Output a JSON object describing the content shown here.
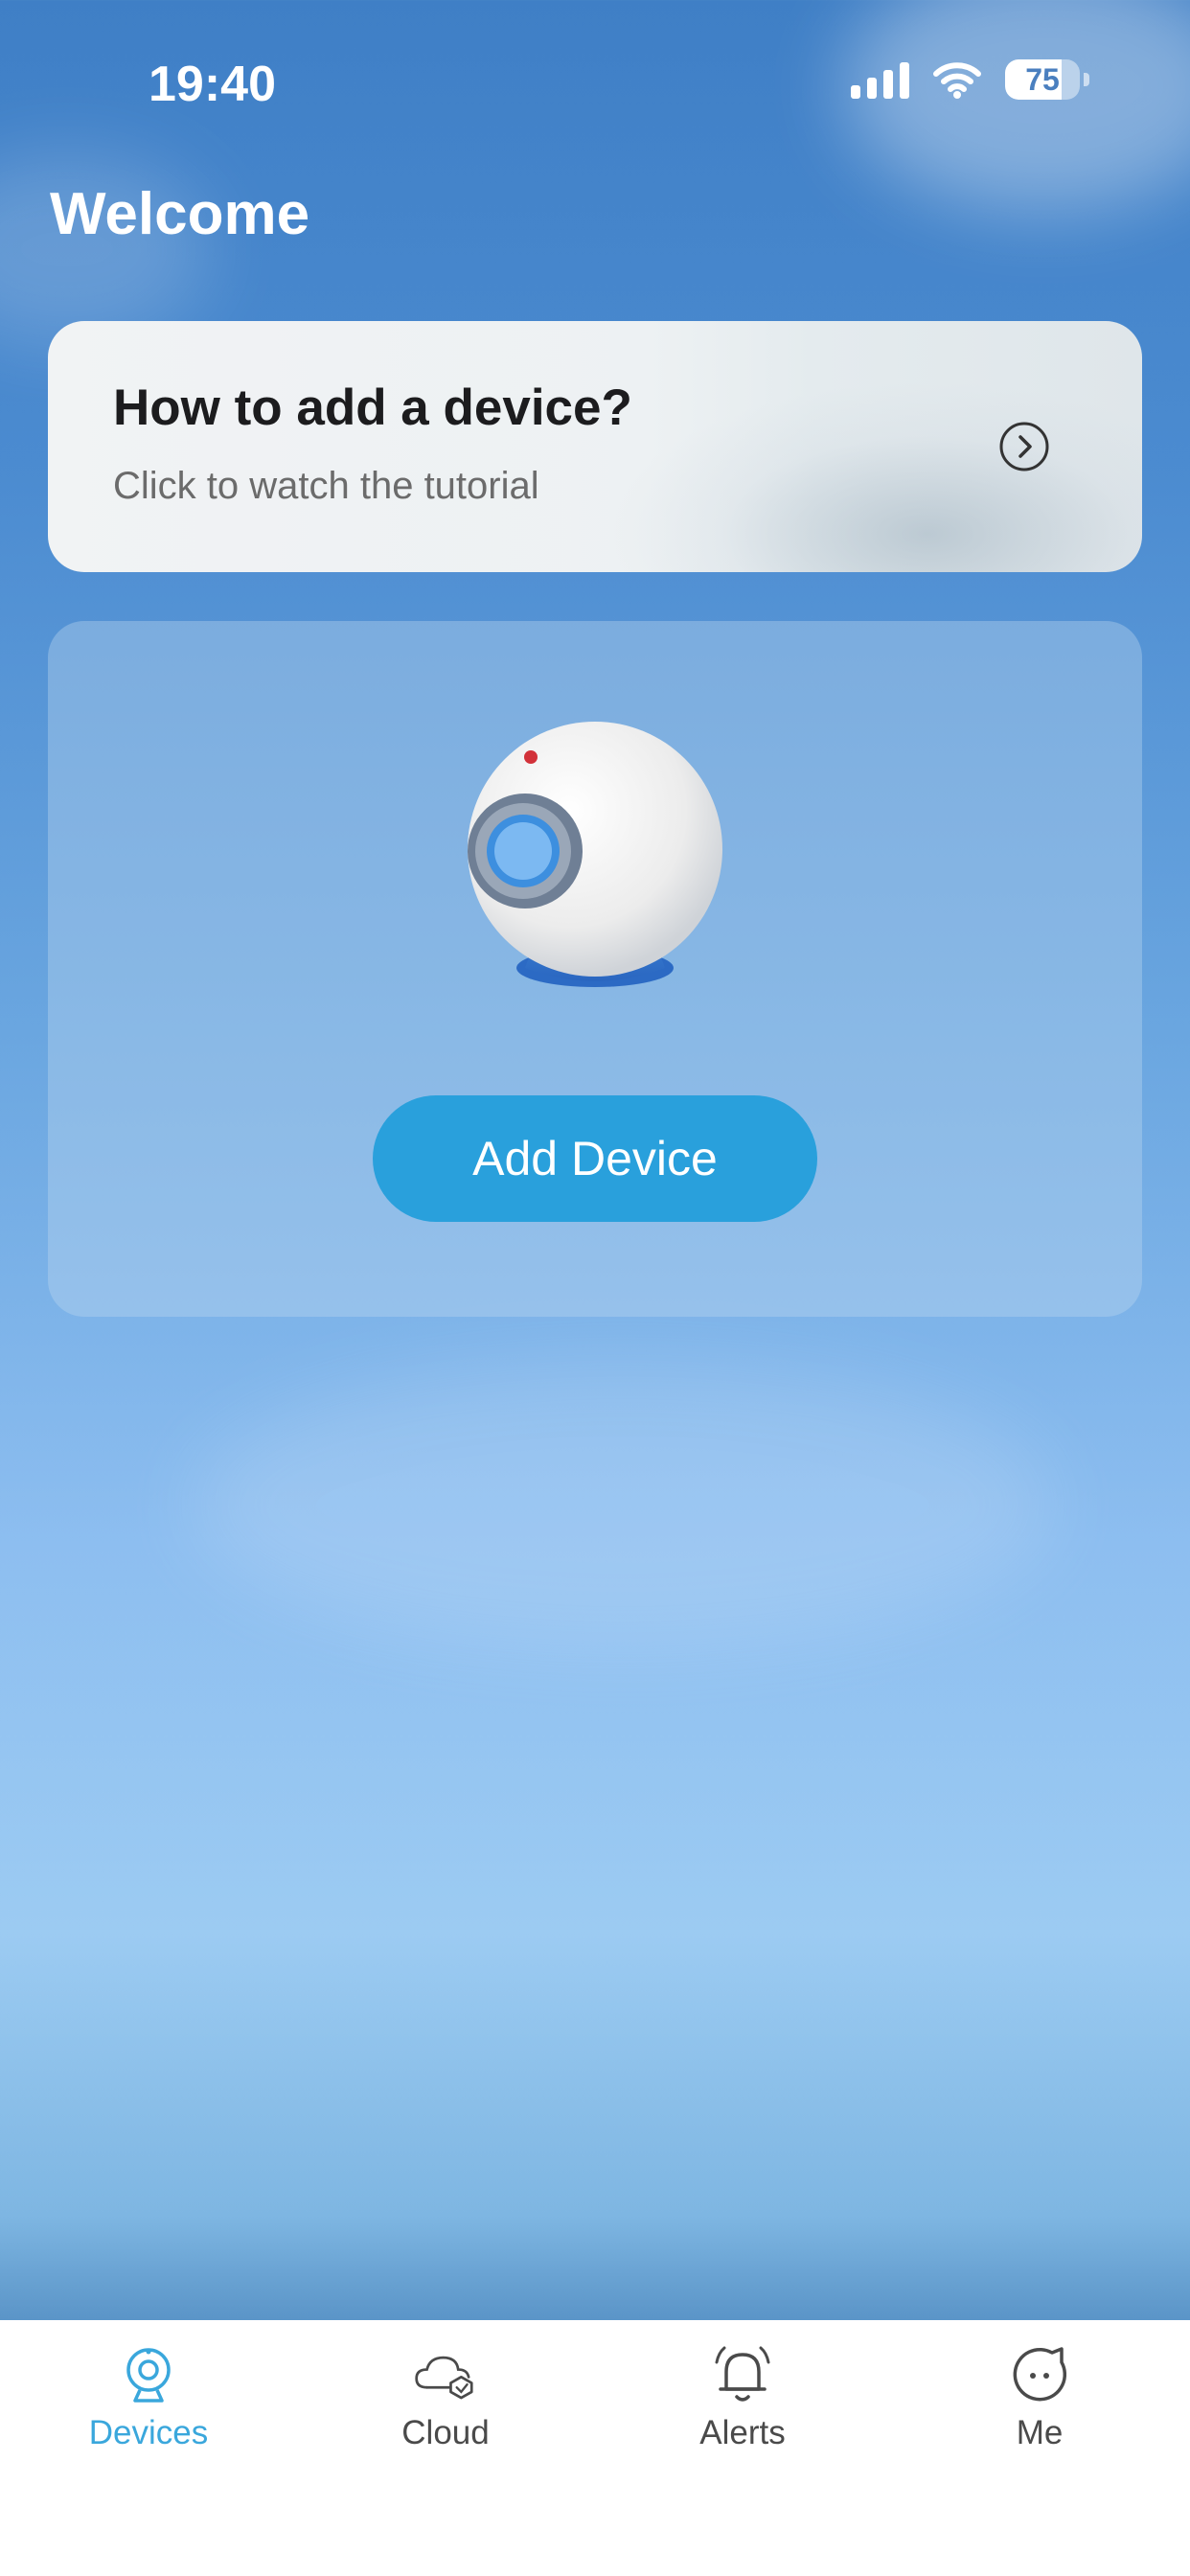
{
  "status_bar": {
    "time": "19:40",
    "battery": "75",
    "battery_level": 0.75
  },
  "header": {
    "title": "Welcome"
  },
  "tutorial": {
    "title": "How to add a device?",
    "subtitle": "Click to watch the tutorial",
    "icon": "chevron-right-circle-icon"
  },
  "device_card": {
    "illustration": "camera-icon",
    "add_button_label": "Add Device"
  },
  "tabs": [
    {
      "label": "Devices",
      "icon": "camera-icon",
      "active": true
    },
    {
      "label": "Cloud",
      "icon": "cloud-icon",
      "active": false
    },
    {
      "label": "Alerts",
      "icon": "bell-icon",
      "active": false
    },
    {
      "label": "Me",
      "icon": "face-icon",
      "active": false
    }
  ],
  "colors": {
    "accent": "#3aa7dc",
    "button": "#29a0dc",
    "tab_inactive": "#4a4a4a"
  }
}
